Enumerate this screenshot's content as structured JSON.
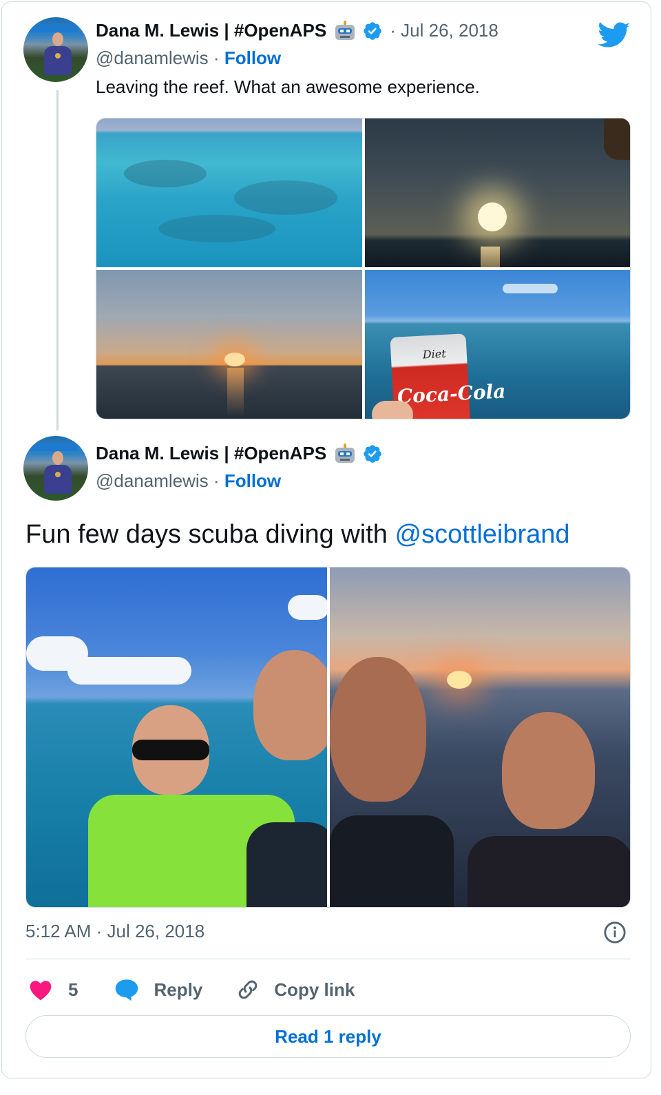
{
  "tweet1": {
    "author_name": "Dana M. Lewis | #OpenAPS",
    "handle": "@danamlewis",
    "follow_label": "Follow",
    "separator": "·",
    "date": "Jul 26, 2018",
    "text": "Leaving the reef. What an awesome experience.",
    "photos": [
      "reef-photo",
      "sunset-horizon-photo",
      "sunset-water-photo",
      "diet-coke-photo"
    ],
    "can_text": "Diet",
    "can_brand": "Coca-Cola"
  },
  "tweet2": {
    "author_name": "Dana M. Lewis | #OpenAPS",
    "handle": "@danamlewis",
    "follow_label": "Follow",
    "separator": "·",
    "text_prefix": "Fun few days scuba diving with ",
    "mention": "@scottleibrand",
    "photos": [
      "daytime-selfie-photo",
      "sunset-selfie-photo"
    ],
    "timestamp": "5:12 AM · Jul 26, 2018"
  },
  "actions": {
    "like_count": "5",
    "reply_label": "Reply",
    "copy_link_label": "Copy link",
    "read_replies_label": "Read 1 reply"
  },
  "colors": {
    "link_blue": "#006fd6",
    "twitter_blue": "#1d9bf0",
    "heart_pink": "#f91880",
    "text_secondary": "#536471",
    "border": "#cfd9de"
  },
  "icons": {
    "brand": "twitter-bird-icon",
    "verified": "verified-badge-icon",
    "robot": "robot-emoji-icon",
    "like": "heart-icon",
    "reply": "speech-bubble-icon",
    "copy": "link-icon",
    "info": "info-icon"
  }
}
